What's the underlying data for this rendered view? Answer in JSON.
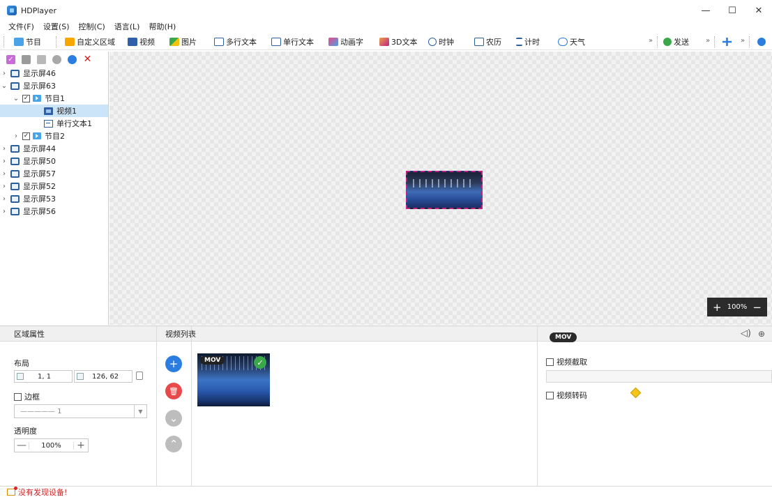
{
  "window": {
    "title": "HDPlayer",
    "minimize": "—",
    "maximize": "☐",
    "close": "✕"
  },
  "menu": [
    "文件(F)",
    "设置(S)",
    "控制(C)",
    "语言(L)",
    "帮助(H)"
  ],
  "toolbar": {
    "program": "节目",
    "custom_area": "自定义区域",
    "video": "视频",
    "image": "图片",
    "multiline_text": "多行文本",
    "singleline_text": "单行文本",
    "animated_text": "动画字",
    "text_3d": "3D文本",
    "clock": "时钟",
    "lunar": "农历",
    "timer": "计时",
    "weather": "天气",
    "send": "发送",
    "more": "»"
  },
  "tree": {
    "screens_top": [
      "显示屏46"
    ],
    "open_screen": "显示屏63",
    "program1": "节目1",
    "video1": "视频1",
    "text1": "单行文本1",
    "program2": "节目2",
    "screens_bottom": [
      "显示屏44",
      "显示屏50",
      "显示屏57",
      "显示屏52",
      "显示屏53",
      "显示屏56"
    ]
  },
  "canvas": {
    "zoom_plus": "+",
    "zoom_level": "100%",
    "zoom_minus": "−"
  },
  "area_props": {
    "header": "区域属性",
    "layout_label": "布局",
    "position": "1, 1",
    "size": "126, 62",
    "border_label": "边框",
    "border_value": "————— 1",
    "opacity_label": "透明度",
    "opacity_value": "100%",
    "op_minus": "—",
    "op_plus": "+"
  },
  "video_list": {
    "header": "视频列表",
    "add": "+",
    "delete": "🗑",
    "down": "⌄",
    "up": "⌃",
    "items": [
      {
        "format": "MOV"
      }
    ]
  },
  "video_props": {
    "format": "MOV",
    "capture_label": "视频截取",
    "transcode_label": "视频转码"
  },
  "status": {
    "text": "没有发现设备!"
  },
  "colors": {
    "accent": "#2b7de0",
    "delete_red": "#e84a4a",
    "neutral_btn": "#bdbdbd",
    "status_red": "#d42020"
  }
}
